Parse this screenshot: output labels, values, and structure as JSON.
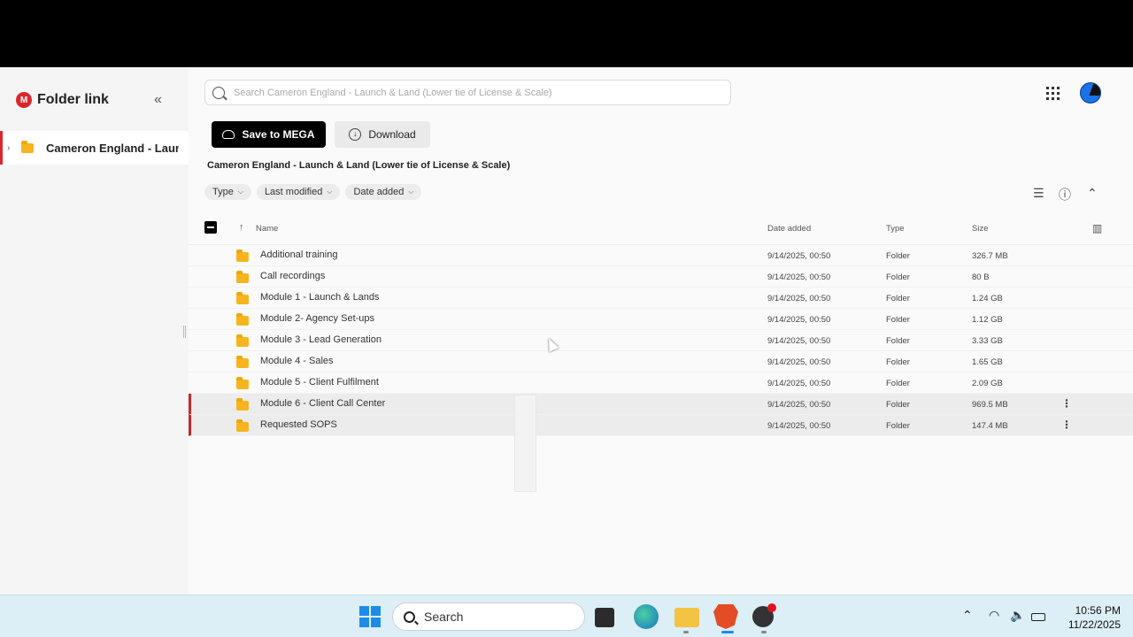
{
  "sidebar": {
    "logo_badge": "M",
    "title": "Folder link",
    "tree_item": "Cameron England - Launch & Land (Lower tie of License & Scale)"
  },
  "search": {
    "placeholder": "Search Cameron England - Launch & Land (Lower tie of License & Scale)"
  },
  "toolbar": {
    "save_label": "Save to MEGA",
    "download_label": "Download"
  },
  "path_title": "Cameron England - Launch & Land (Lower tie of License & Scale)",
  "filters": [
    "Type",
    "Last modified",
    "Date added"
  ],
  "table": {
    "headers": {
      "name": "Name",
      "date_added": "Date added",
      "type": "Type",
      "size": "Size"
    },
    "rows": [
      {
        "name": "Additional training",
        "date": "9/14/2025, 00:50",
        "type": "Folder",
        "size": "326.7 MB"
      },
      {
        "name": "Call recordings",
        "date": "9/14/2025, 00:50",
        "type": "Folder",
        "size": "80 B"
      },
      {
        "name": "Module 1 - Launch & Lands",
        "date": "9/14/2025, 00:50",
        "type": "Folder",
        "size": "1.24 GB"
      },
      {
        "name": "Module 2- Agency Set-ups",
        "date": "9/14/2025, 00:50",
        "type": "Folder",
        "size": "1.12 GB"
      },
      {
        "name": "Module 3 - Lead Generation",
        "date": "9/14/2025, 00:50",
        "type": "Folder",
        "size": "3.33 GB"
      },
      {
        "name": "Module 4 - Sales",
        "date": "9/14/2025, 00:50",
        "type": "Folder",
        "size": "1.65 GB"
      },
      {
        "name": "Module 5 - Client Fulfilment",
        "date": "9/14/2025, 00:50",
        "type": "Folder",
        "size": "2.09 GB"
      },
      {
        "name": "Module 6 - Client Call Center",
        "date": "9/14/2025, 00:50",
        "type": "Folder",
        "size": "969.5 MB"
      },
      {
        "name": "Requested SOPS",
        "date": "9/14/2025, 00:50",
        "type": "Folder",
        "size": "147.4 MB"
      }
    ]
  },
  "taskbar": {
    "search_label": "Search",
    "time": "10:56 PM",
    "date": "11/22/2025"
  },
  "colors": {
    "accent": "#d9272e",
    "folder": "#f6b51e",
    "primary_button": "#000000"
  }
}
